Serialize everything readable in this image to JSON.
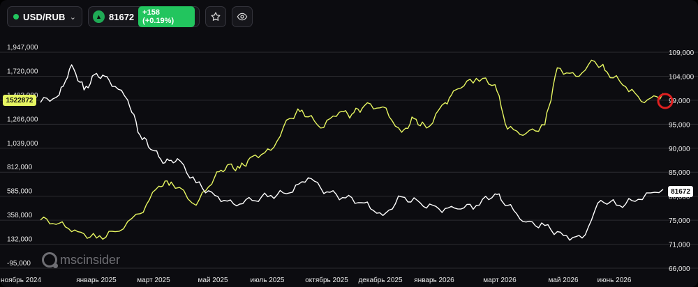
{
  "header": {
    "symbol": "USD/RUB",
    "dropdown_icon": "chevron-down-icon",
    "price": "81672",
    "change": "+158 (+0.19%)",
    "favorite_icon": "star-icon",
    "watch_icon": "eye-icon"
  },
  "colors": {
    "yellow_series": "#e6f561",
    "white_series": "#ffffff",
    "up": "#22c55e",
    "marker": "#e02020"
  },
  "watermark": "mscinsider",
  "tags": {
    "left_value": "1522872",
    "right_value": "81672"
  },
  "chart_data": {
    "type": "line",
    "grid": true,
    "x_ticks": [
      "ноябрь 2024",
      "январь 2025",
      "март 2025",
      "май 2025",
      "июль 2025",
      "октябрь 2025",
      "декабрь 2025",
      "январь 2026",
      "март 2026",
      "май 2026",
      "июнь 2026"
    ],
    "left_axis": {
      "ticks": [
        "1,947,000",
        "1,720,000",
        "1,493,000",
        "1,266,000",
        "1,039,000",
        "812,000",
        "585,000",
        "358,000",
        "132,000",
        "-95,000"
      ],
      "range": [
        -95000,
        1947000
      ]
    },
    "right_axis": {
      "ticks": [
        "109,000",
        "104,000",
        "99,000",
        "95,000",
        "90,000",
        "85,000",
        "80,000",
        "75,000",
        "71,000",
        "66,000"
      ],
      "range": [
        66000,
        109000
      ]
    },
    "series": [
      {
        "axis": "left",
        "color": "#e6f561",
        "x": [
          0,
          0.03,
          0.06,
          0.09,
          0.12,
          0.16,
          0.19,
          0.21,
          0.25,
          0.28,
          0.3,
          0.32,
          0.34,
          0.37,
          0.4,
          0.42,
          0.45,
          0.48,
          0.5,
          0.52,
          0.55,
          0.58,
          0.6,
          0.62,
          0.65,
          0.67,
          0.7,
          0.73,
          0.75,
          0.78,
          0.81,
          0.83,
          0.86,
          0.89,
          0.91,
          0.94,
          0.97,
          1.0
        ],
        "y": [
          360000,
          330000,
          250000,
          190000,
          250000,
          420000,
          680000,
          720000,
          500000,
          770000,
          880000,
          850000,
          960000,
          1020000,
          1320000,
          1400000,
          1230000,
          1380000,
          1360000,
          1440000,
          1430000,
          1190000,
          1320000,
          1230000,
          1470000,
          1600000,
          1700000,
          1640000,
          1220000,
          1180000,
          1260000,
          1800000,
          1720000,
          1860000,
          1760000,
          1620000,
          1470000,
          1560000
        ]
      },
      {
        "axis": "right",
        "color": "#ffffff",
        "x": [
          0,
          0.03,
          0.05,
          0.07,
          0.09,
          0.11,
          0.14,
          0.16,
          0.18,
          0.2,
          0.22,
          0.25,
          0.28,
          0.31,
          0.34,
          0.37,
          0.4,
          0.43,
          0.46,
          0.49,
          0.52,
          0.55,
          0.58,
          0.61,
          0.64,
          0.67,
          0.7,
          0.73,
          0.75,
          0.78,
          0.81,
          0.84,
          0.87,
          0.9,
          0.93,
          0.96,
          1.0
        ],
        "y": [
          99000,
          100500,
          106500,
          101500,
          104800,
          103500,
          99500,
          92500,
          89500,
          87000,
          87800,
          83000,
          80500,
          78800,
          79500,
          80500,
          81000,
          84000,
          81200,
          80000,
          79000,
          76500,
          80200,
          79000,
          77800,
          77800,
          78500,
          80800,
          78500,
          75200,
          74500,
          72500,
          72000,
          79500,
          78500,
          79700,
          81700
        ]
      }
    ]
  }
}
